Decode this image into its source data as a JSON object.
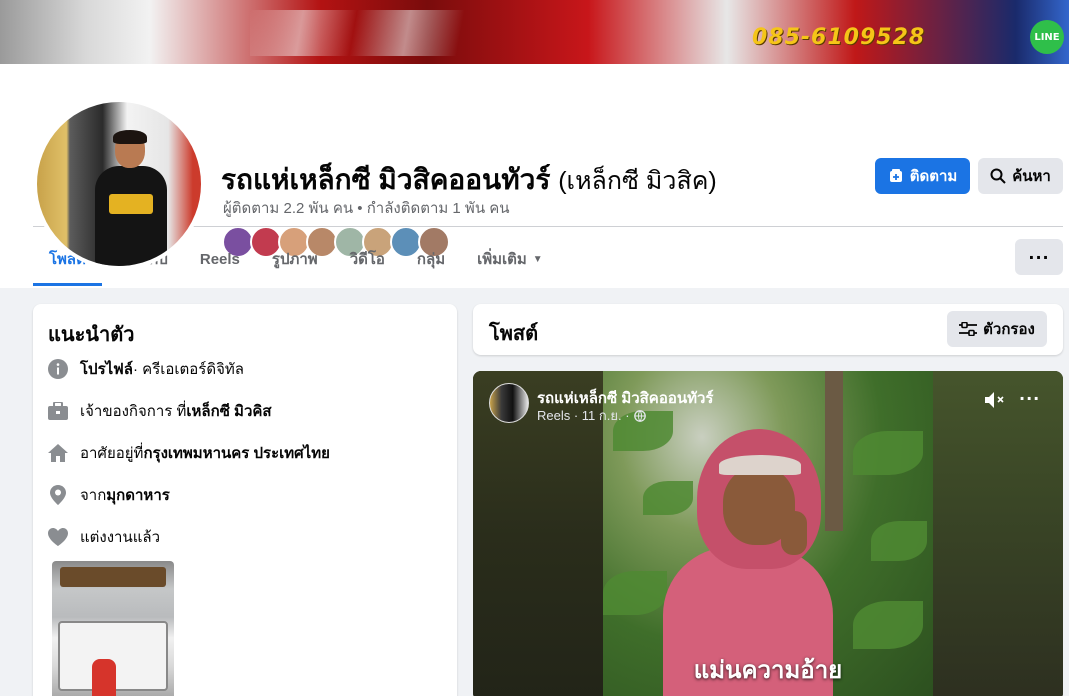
{
  "cover": {
    "phone": "085-6109528",
    "line_badge": "LINE"
  },
  "profile": {
    "name": "รถแห่เหล็กซี มิวสิคออนทัวร์",
    "alt_name": "(เหล็กซี มิวสิค)",
    "followers_text": "ผู้ติดตาม 2.2 พัน คน • กำลังติดตาม 1 พัน คน"
  },
  "actions": {
    "follow_label": "ติดตาม",
    "search_label": "ค้นหา"
  },
  "tabs": [
    {
      "label": "โพสต์"
    },
    {
      "label": "เกี่ยวกับ"
    },
    {
      "label": "Reels"
    },
    {
      "label": "รูปภาพ"
    },
    {
      "label": "วิดีโอ"
    },
    {
      "label": "กลุ่ม"
    },
    {
      "label": "เพิ่มเติม"
    }
  ],
  "more_button": "···",
  "intro": {
    "title": "แนะนำตัว",
    "profile_label": "โปรไฟล์",
    "profile_sub": " · ครีเอเตอร์ดิจิทัล",
    "owner_prefix": "เจ้าของกิจการ ที่ ",
    "owner_value": "เหล็กซี มิวคิส",
    "lives_prefix": "อาศัยอยู่ที่ ",
    "lives_value": "กรุงเทพมหานคร ประเทศไทย",
    "from_prefix": "จาก ",
    "from_value": "มุกดาหาร",
    "relationship": "แต่งงานแล้ว"
  },
  "posts": {
    "title": "โพสต์",
    "filter_label": "ตัวกรอง"
  },
  "post": {
    "author": "รถแห่เหล็กซี มิวสิคออนทัวร์",
    "meta": "Reels · 11 ก.ย. ·",
    "caption": "แม่นความอ้าย",
    "menu": "···"
  },
  "colors": {
    "accent": "#1b74e4",
    "secondary_btn": "#e4e6eb",
    "muted_text": "#65676b",
    "background": "#f0f2f5"
  },
  "friend_avatars": [
    "#7a4fa0",
    "#c23b4f",
    "#d7a07a",
    "#b88868",
    "#9fb6a6",
    "#c9a37a",
    "#5c8fb8",
    "#a27a65"
  ]
}
